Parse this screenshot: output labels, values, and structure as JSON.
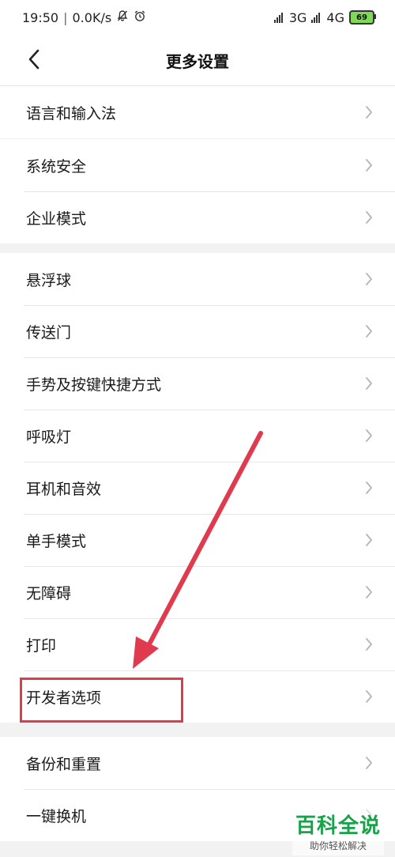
{
  "status_bar": {
    "time": "19:50",
    "network_speed": "0.0K/s",
    "net1": "3G",
    "net2": "4G",
    "battery": "69"
  },
  "header": {
    "title": "更多设置"
  },
  "groups": [
    {
      "items": [
        {
          "label": "语言和输入法"
        }
      ]
    },
    {
      "items": [
        {
          "label": "系统安全"
        },
        {
          "label": "企业模式"
        }
      ]
    },
    {
      "items": [
        {
          "label": "悬浮球"
        },
        {
          "label": "传送门"
        },
        {
          "label": "手势及按键快捷方式"
        },
        {
          "label": "呼吸灯"
        },
        {
          "label": "耳机和音效"
        },
        {
          "label": "单手模式"
        },
        {
          "label": "无障碍"
        },
        {
          "label": "打印"
        },
        {
          "label": "开发者选项"
        }
      ]
    },
    {
      "items": [
        {
          "label": "备份和重置"
        },
        {
          "label": "一键换机"
        }
      ]
    }
  ],
  "annotation": {
    "color": "#e03a4e"
  },
  "watermark": {
    "title": "百科全说",
    "subtitle": "助你轻松解决",
    "color": "#19a24a"
  },
  "colors": {
    "background": "#f2f2f2",
    "row_bg": "#ffffff",
    "chevron": "#b5b5b5"
  }
}
